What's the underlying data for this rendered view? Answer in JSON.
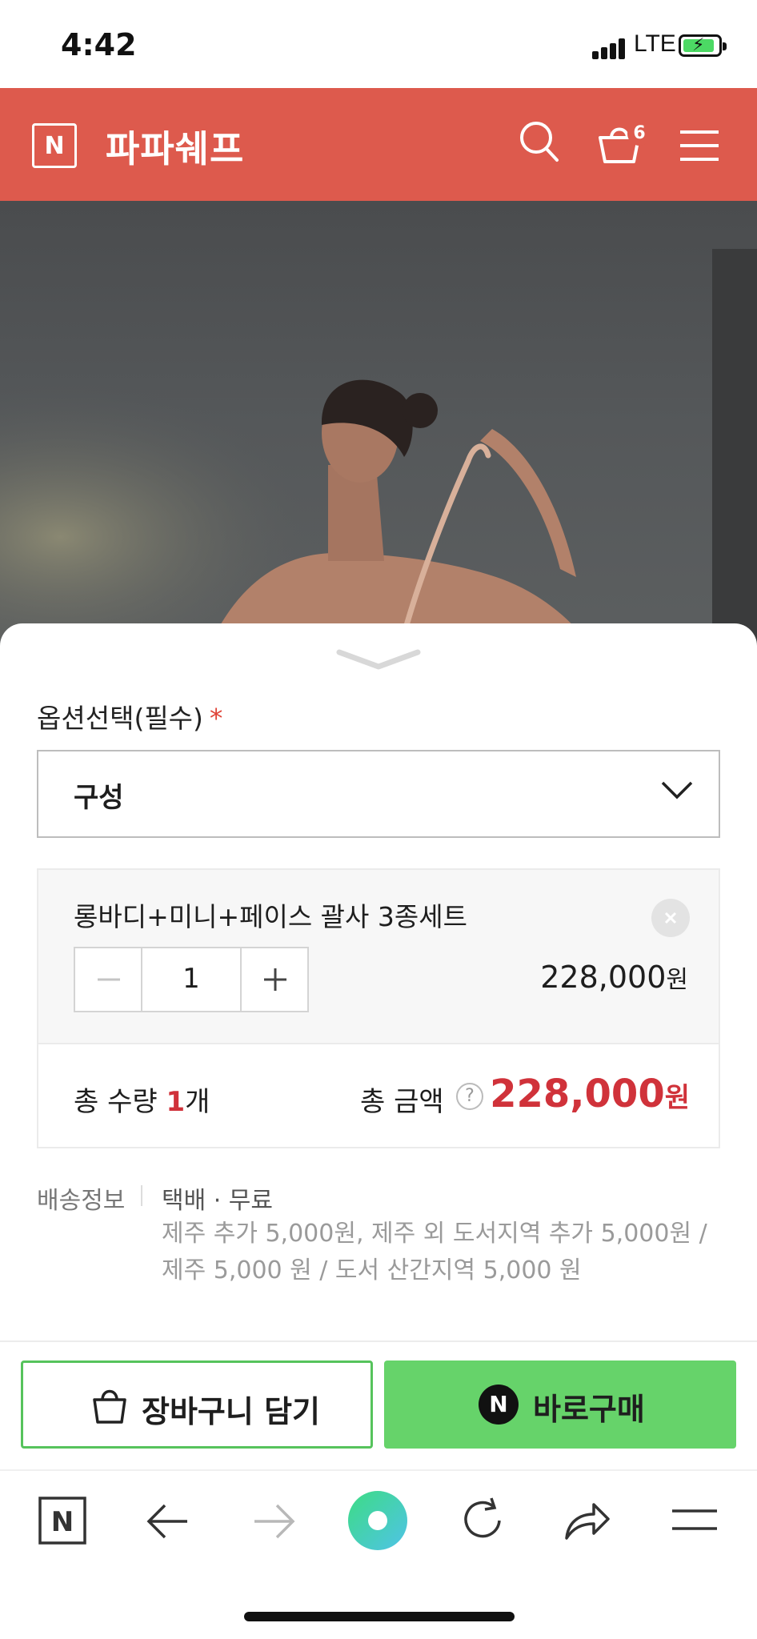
{
  "status_bar": {
    "time": "4:42",
    "network": "LTE"
  },
  "header": {
    "logo_letter": "N",
    "store_name": "파파쉐프",
    "cart_count": "6"
  },
  "options": {
    "label": "옵션선택(필수)",
    "required_mark": "*",
    "select_value": "구성"
  },
  "selected_item": {
    "name": "롱바디+미니+페이스 괄사 3종세트",
    "quantity": "1",
    "price": "228,000",
    "currency": "원"
  },
  "totals": {
    "qty_prefix": "총 수량 ",
    "qty_value": "1",
    "qty_suffix": "개",
    "amount_label": "총 금액",
    "help": "?",
    "amount": "228,000",
    "currency": "원"
  },
  "shipping": {
    "label": "배송정보",
    "main": "택배 · 무료",
    "note_line1": "제주 추가 5,000원, 제주 외 도서지역 추가 5,000원 /",
    "note_line2": "제주 5,000 원 / 도서 산간지역 5,000 원"
  },
  "actions": {
    "cart_label": "장바구니 담기",
    "buy_icon": "N",
    "buy_label": "바로구매"
  },
  "browser_nav": {
    "home_letter": "N"
  },
  "colors": {
    "brand": "#dd5a4d",
    "price_red": "#d0323a",
    "buy_green": "#66d36a",
    "cart_border": "#56c35c"
  }
}
